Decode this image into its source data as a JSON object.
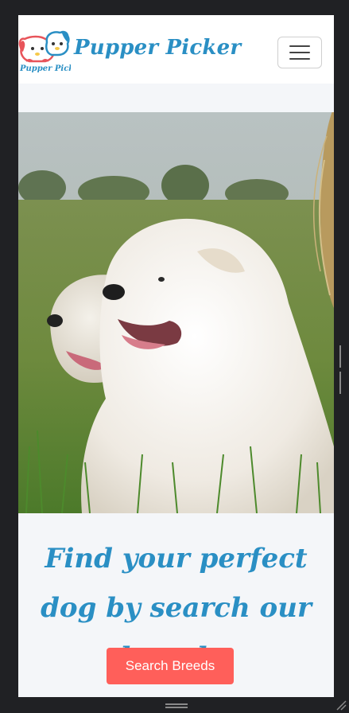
{
  "navbar": {
    "brand": "Pupper Picker",
    "logo_text": "Pupper Picker",
    "toggle_icon": "hamburger-menu-icon"
  },
  "hero": {
    "image_description_icon": "great-pyrenees-dogs-photo"
  },
  "main": {
    "headline": "Find your perfect dog by search our breeds.",
    "cta_label": "Search Breeds"
  },
  "colors": {
    "brand_blue": "#2a8fc4",
    "cta_red": "#ff5f5a",
    "page_bg": "#f4f6f9",
    "frame_bg": "#202124"
  }
}
